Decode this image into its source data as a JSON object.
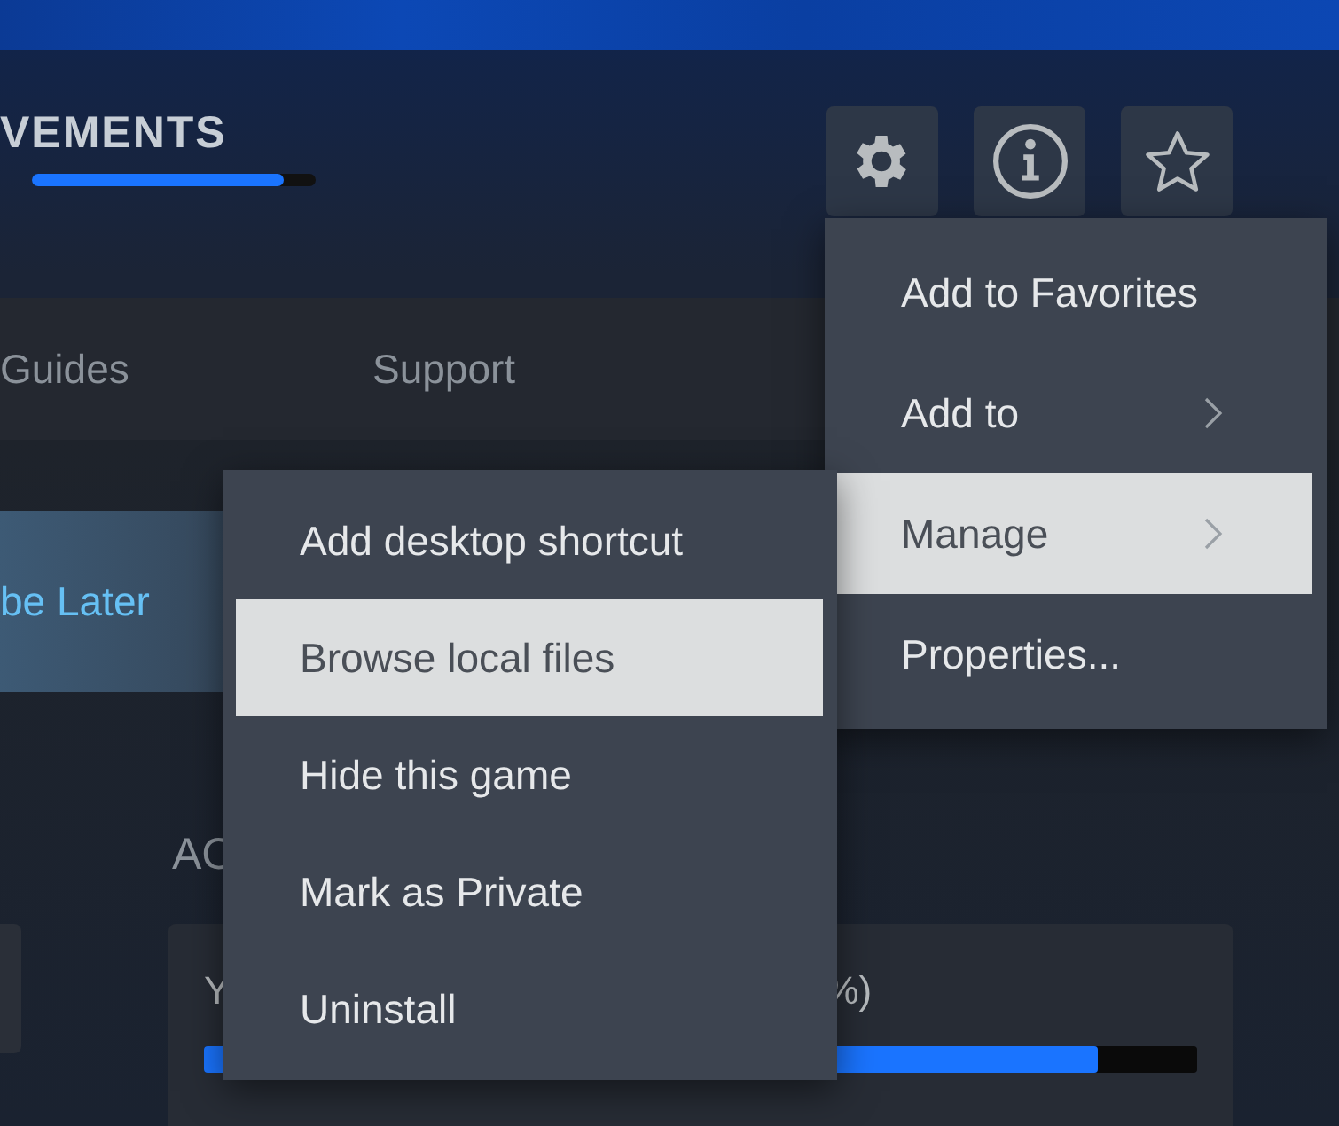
{
  "header": {
    "title": "VEMENTS",
    "progress": {
      "level": 0.89
    }
  },
  "header_buttons": [
    {
      "kind": "settings"
    },
    {
      "kind": "info"
    },
    {
      "kind": "favorite"
    }
  ],
  "tabs": [
    {
      "label": "Guides"
    },
    {
      "label": "Support"
    }
  ],
  "action_button": {
    "label": "be Later"
  },
  "section": {
    "title": "AC",
    "card": {
      "column_1": "Y",
      "column_2": "%)",
      "progress": {
        "level": 0.9
      }
    }
  },
  "context_menu": {
    "items": [
      {
        "label": "Add to Favorites",
        "submenu": false,
        "selected": false
      },
      {
        "label": "Add to",
        "submenu": true,
        "selected": false
      },
      {
        "label": "Manage",
        "submenu": true,
        "selected": true
      },
      {
        "label": "Properties...",
        "submenu": false,
        "selected": false
      }
    ]
  },
  "submenu": {
    "items": [
      {
        "label": "Add desktop shortcut",
        "selected": false
      },
      {
        "label": "Browse local files",
        "selected": true
      },
      {
        "label": "Hide this game",
        "selected": false
      },
      {
        "label": "Mark as Private",
        "selected": false
      },
      {
        "label": "Uninstall",
        "selected": false
      }
    ]
  }
}
